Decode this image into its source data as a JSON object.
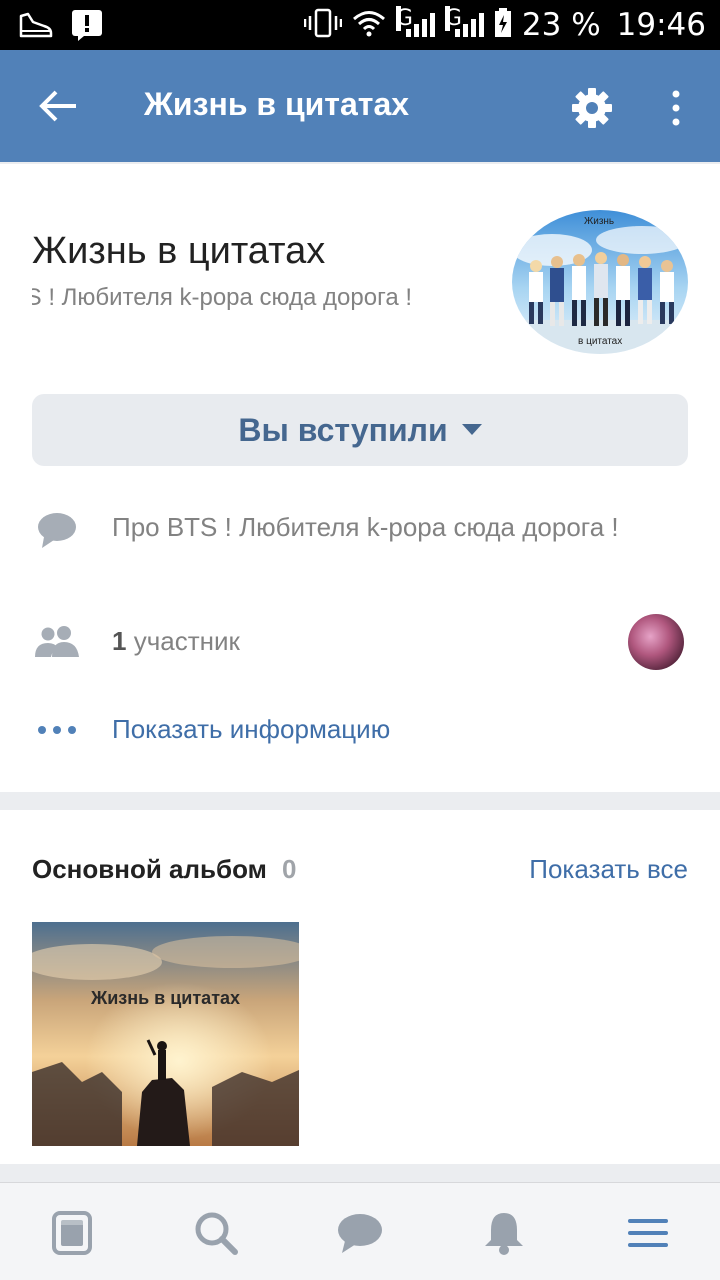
{
  "status_bar": {
    "battery_percent": "23 %",
    "time": "19:46",
    "network_1": "G",
    "network_2": "G",
    "icons": [
      "sneaker-icon",
      "alert-icon",
      "vibrate-icon",
      "wifi-icon",
      "signal-icon",
      "battery-icon"
    ]
  },
  "app_bar": {
    "title": "Жизнь в цитатах",
    "icons": [
      "back-arrow-icon",
      "gear-icon",
      "more-vertical-icon"
    ]
  },
  "group": {
    "name": "Жизнь в цитатах",
    "status": "Про BTS ! Любителя k-pора сюда дорога !",
    "avatar_caption_top": "Жизнь",
    "avatar_caption_bottom": "в цитатах"
  },
  "join_button": {
    "label": "Вы вступили"
  },
  "info": {
    "description": "Про BTS ! Любителя k-pора сюда дорога !",
    "members_count": "1",
    "members_label": "участник",
    "show_info": "Показать информацию"
  },
  "album": {
    "title": "Основной альбом",
    "count": "0",
    "show_all": "Показать все",
    "thumbnail_text": "Жизнь в цитатах"
  },
  "bottom_nav": {
    "items": [
      "news-icon",
      "search-icon",
      "messages-icon",
      "notifications-icon",
      "menu-icon"
    ]
  },
  "colors": {
    "accent": "#5181b8",
    "link": "#3f6ea8",
    "button_text": "#45678f",
    "icon_gray": "#99a2ad"
  }
}
